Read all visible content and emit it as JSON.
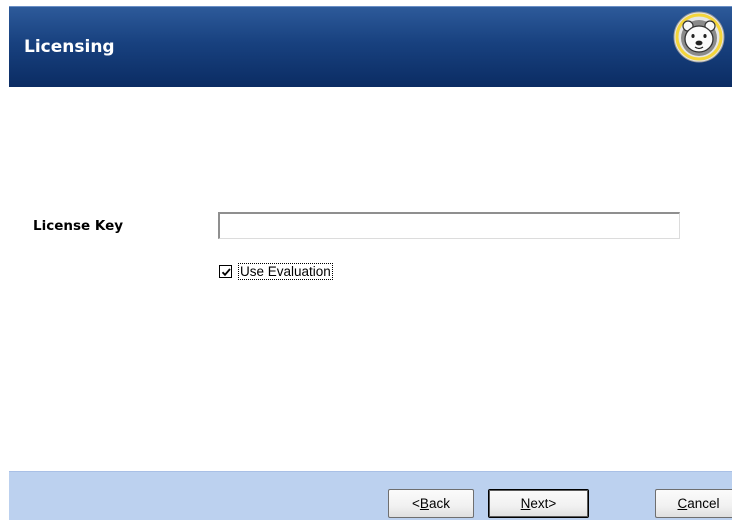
{
  "header": {
    "title": "Licensing",
    "logo_icon": "polar-bear-logo-icon"
  },
  "form": {
    "license_key_label": "License Key",
    "license_key_value": "",
    "use_evaluation_label": "Use Evaluation",
    "use_evaluation_checked": true
  },
  "footer": {
    "back_prefix": "<",
    "back_mnemonic": "B",
    "back_rest": "ack",
    "next_mnemonic": "N",
    "next_rest": "ext>",
    "cancel_mnemonic": "C",
    "cancel_rest": "ancel"
  },
  "colors": {
    "header_bg": "#18417f",
    "footer_bg": "#bcd1ef",
    "content_bg": "#ffffff"
  }
}
